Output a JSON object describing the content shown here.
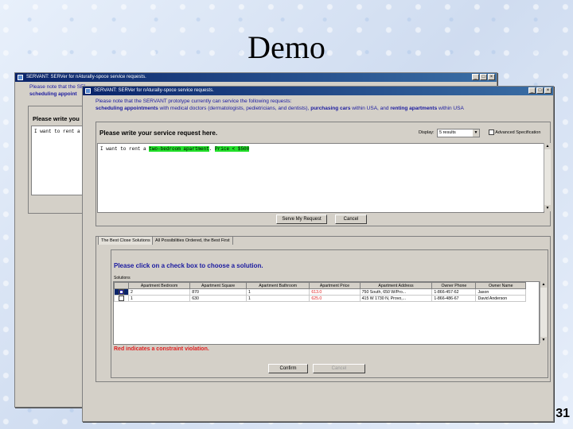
{
  "slide": {
    "title": "Demo",
    "page": "31"
  },
  "back_window": {
    "title": "SERVANT: SERVer for nAturalIy-spoce service requests.",
    "notice_line1": "Please note that the SERVANT prototype currently can service the following requests:",
    "notice_line2_bold": "scheduling appoint",
    "prompt": "Please write you",
    "request_text": "I want to rent a"
  },
  "front_window": {
    "title": "SERVANT: SERVer for nAturalIy-spoce service requests.",
    "notice_line1": "Please note that the SERVANT prototype currently can service the following requests:",
    "notice_line2_bold_a": "scheduling appointments",
    "notice_line2_a": " with medical doctors (dermatologists, pedietricians, and dentists),",
    "notice_line2_bold_b": "purchasing cars",
    "notice_line2_b": " within USA, and",
    "notice_line2_bold_c": "renting apartments",
    "notice_line2_c": " within USA",
    "prompt": "Please write your service request here.",
    "display_label": "Display:",
    "display_value": "5 results",
    "advanced_label": "Advanced Specification",
    "request_prefix": "I want to rent a ",
    "request_hl1": "two-bedroom apartment",
    "request_mid": ". ",
    "request_hl2": "Price < $500",
    "serve_button": "Serve My Request",
    "cancel_button": "Cancel",
    "tabs": [
      "The Best Close Solutions",
      "All Possibilities Ordered, the Best First"
    ],
    "instruction": "Please click on a check box to choose a solution.",
    "solutions_label": "Solutions",
    "columns": [
      "",
      "Apartment Bedroom",
      "Apartment Square",
      "Apartment Bathroom",
      "Apartment Price",
      "Apartment Address",
      "Owner Phone",
      "Owner Name"
    ],
    "rows": [
      [
        "2",
        "870",
        "1",
        "613.0",
        "750 South, 650 W/Pro...",
        "1-866-457-62",
        "Jason"
      ],
      [
        "1",
        "630",
        "1",
        "625.0",
        "415 W 1730 N, Provo,...",
        "1-866-486-67",
        "David Anderson"
      ]
    ],
    "violation_note": "Red indicates a constraint violation.",
    "confirm_button": "Confirm",
    "cancel2_button": "Cancel"
  }
}
